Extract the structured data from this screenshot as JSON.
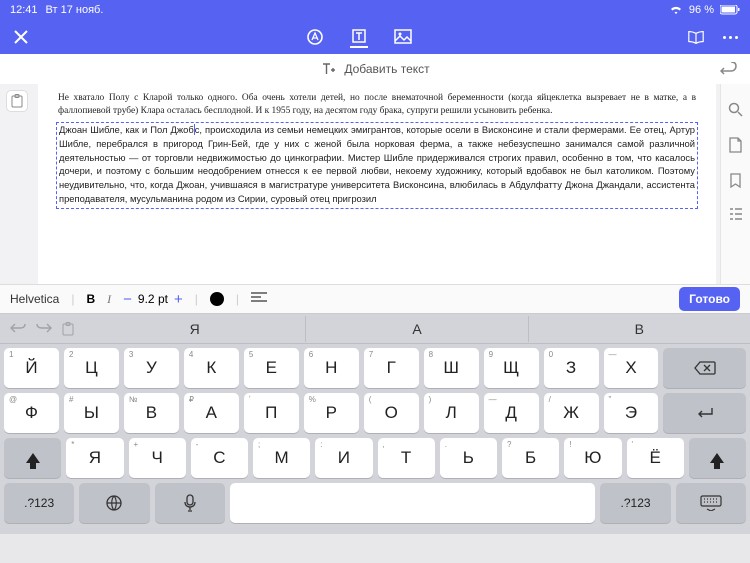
{
  "statusbar": {
    "time": "12:41",
    "date": "Вт 17 нояб.",
    "battery": "96 %"
  },
  "addtext": {
    "label": "Добавить текст"
  },
  "document": {
    "para1": "Не хватало Полу с Кларой только одного. Оба очень хотели детей, но после внематочной беременности (когда яйцеклетка вызревает не в матке, а в фаллопиевой трубе) Клара осталась бесплодной. И к 1955 году, на десятом году брака, супруги решили усыновить ребенка.",
    "para2a": "Джоан Шибле, как и Пол Джоб",
    "para2b": "с, происходила из семьи немецких эмигрантов, которые осели в Висконсине и стали фермерами. Ее отец, Артур Шибле, перебрался в пригород Грин-Бей, где у них с женой была норковая ферма, а также небезуспешно занимался самой различной деятельностью — от торговли недвижимостью до цинкографии. Мистер Шибле придерживался строгих правил, особенно в том, что касалось дочери, и поэтому с большим неодобрением отнесся к ее первой любви, некоему художнику, который вдобавок не был католиком. Поэтому неудивительно, что, когда Джоан, учившаяся в магистратуре университета Висконсина, влюбилась в Абдулфатту Джона Джандали, ассистента преподавателя, мусульманина родом из Сирии, суровый отец пригрозил"
  },
  "format": {
    "font": "Helvetica",
    "bold": "B",
    "italic": "I",
    "size": "9.2 pt",
    "done": "Готово"
  },
  "suggest": {
    "s1": "Я",
    "s2": "А",
    "s3": "В"
  },
  "keyboard": {
    "row1": [
      {
        "c": "Й",
        "h": "1"
      },
      {
        "c": "Ц",
        "h": "2"
      },
      {
        "c": "У",
        "h": "3"
      },
      {
        "c": "К",
        "h": "4"
      },
      {
        "c": "Е",
        "h": "5"
      },
      {
        "c": "Н",
        "h": "6"
      },
      {
        "c": "Г",
        "h": "7"
      },
      {
        "c": "Ш",
        "h": "8"
      },
      {
        "c": "Щ",
        "h": "9"
      },
      {
        "c": "З",
        "h": "0"
      },
      {
        "c": "Х",
        "h": "—"
      }
    ],
    "row2": [
      {
        "c": "Ф",
        "h": "@"
      },
      {
        "c": "Ы",
        "h": "#"
      },
      {
        "c": "В",
        "h": "№"
      },
      {
        "c": "А",
        "h": "₽"
      },
      {
        "c": "П",
        "h": "ʼ"
      },
      {
        "c": "Р",
        "h": "%"
      },
      {
        "c": "О",
        "h": "("
      },
      {
        "c": "Л",
        "h": ")"
      },
      {
        "c": "Д",
        "h": "—"
      },
      {
        "c": "Ж",
        "h": "/"
      },
      {
        "c": "Э",
        "h": "\""
      }
    ],
    "row3": [
      {
        "c": "Я",
        "h": "*"
      },
      {
        "c": "Ч",
        "h": "+"
      },
      {
        "c": "С",
        "h": "-"
      },
      {
        "c": "М",
        "h": ";"
      },
      {
        "c": "И",
        "h": ":"
      },
      {
        "c": "Т",
        "h": ","
      },
      {
        "c": "Ь",
        "h": "."
      },
      {
        "c": "Б",
        "h": "?"
      },
      {
        "c": "Ю",
        "h": "!"
      },
      {
        "c": "Ё",
        "h": "'"
      }
    ],
    "numkey": ".?123"
  }
}
